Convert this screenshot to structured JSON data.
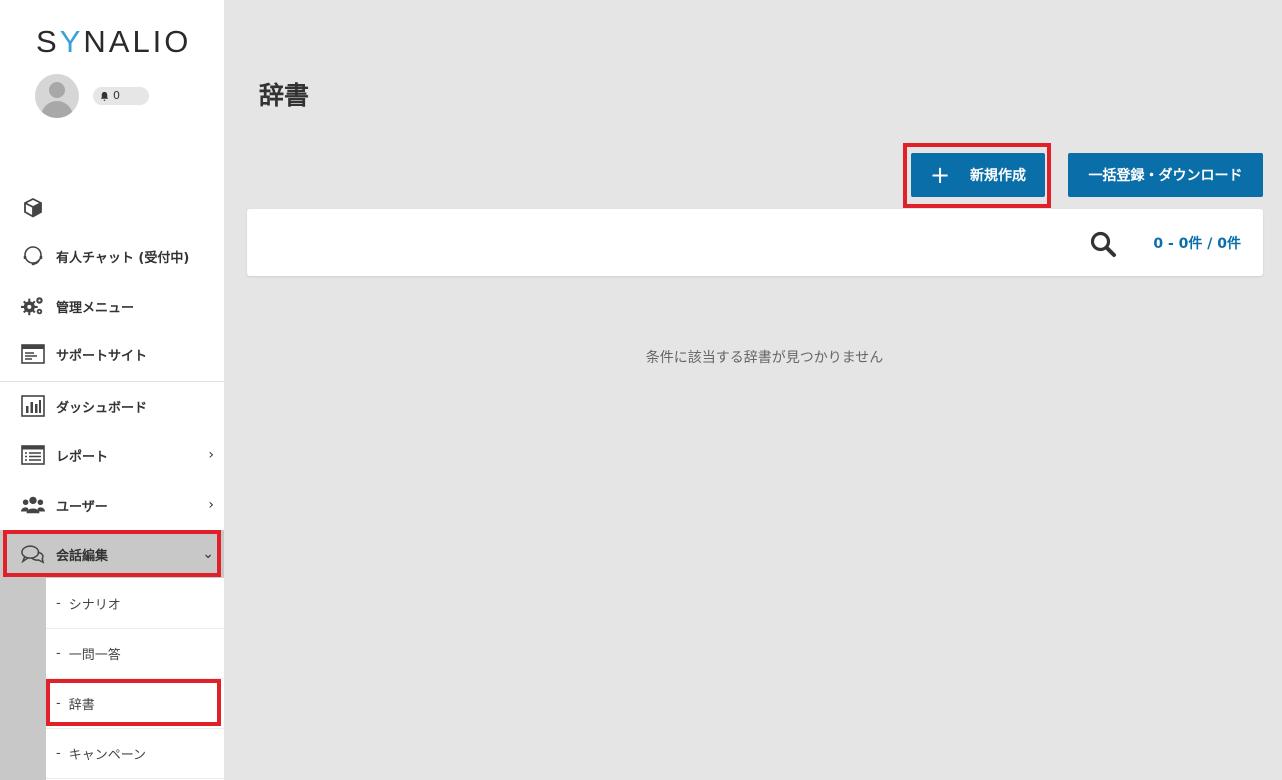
{
  "app": {
    "logo_prefix": "S",
    "logo_accent": "Y",
    "logo_suffix": "NALIO",
    "notification_count": "0"
  },
  "sidebar": {
    "items": [
      {
        "label": "",
        "icon": "box-icon"
      },
      {
        "label": "有人チャット (受付中)",
        "icon": "headset-icon"
      },
      {
        "label": "管理メニュー",
        "icon": "gears-icon"
      },
      {
        "label": "サポートサイト",
        "icon": "browser-window-icon"
      },
      {
        "label": "ダッシュボード",
        "icon": "bar-chart-icon"
      },
      {
        "label": "レポート",
        "icon": "list-icon",
        "chevron": "›"
      },
      {
        "label": "ユーザー",
        "icon": "users-icon",
        "chevron": "›"
      },
      {
        "label": "会話編集",
        "icon": "chat-bubbles-icon",
        "chevron": "⌄"
      }
    ],
    "subitems": [
      {
        "label": "シナリオ"
      },
      {
        "label": "一問一答"
      },
      {
        "label": "辞書"
      },
      {
        "label": "キャンペーン"
      }
    ],
    "dash": "-"
  },
  "main": {
    "title": "辞書",
    "new_button": "新規作成",
    "bulk_button": "一括登録・ダウンロード",
    "count": "0 - 0件 / 0件",
    "empty_message": "条件に該当する辞書が見つかりません"
  },
  "colors": {
    "accent": "#0a6ea9",
    "highlight": "#e0212a",
    "active_bg": "#c8c8c8"
  }
}
